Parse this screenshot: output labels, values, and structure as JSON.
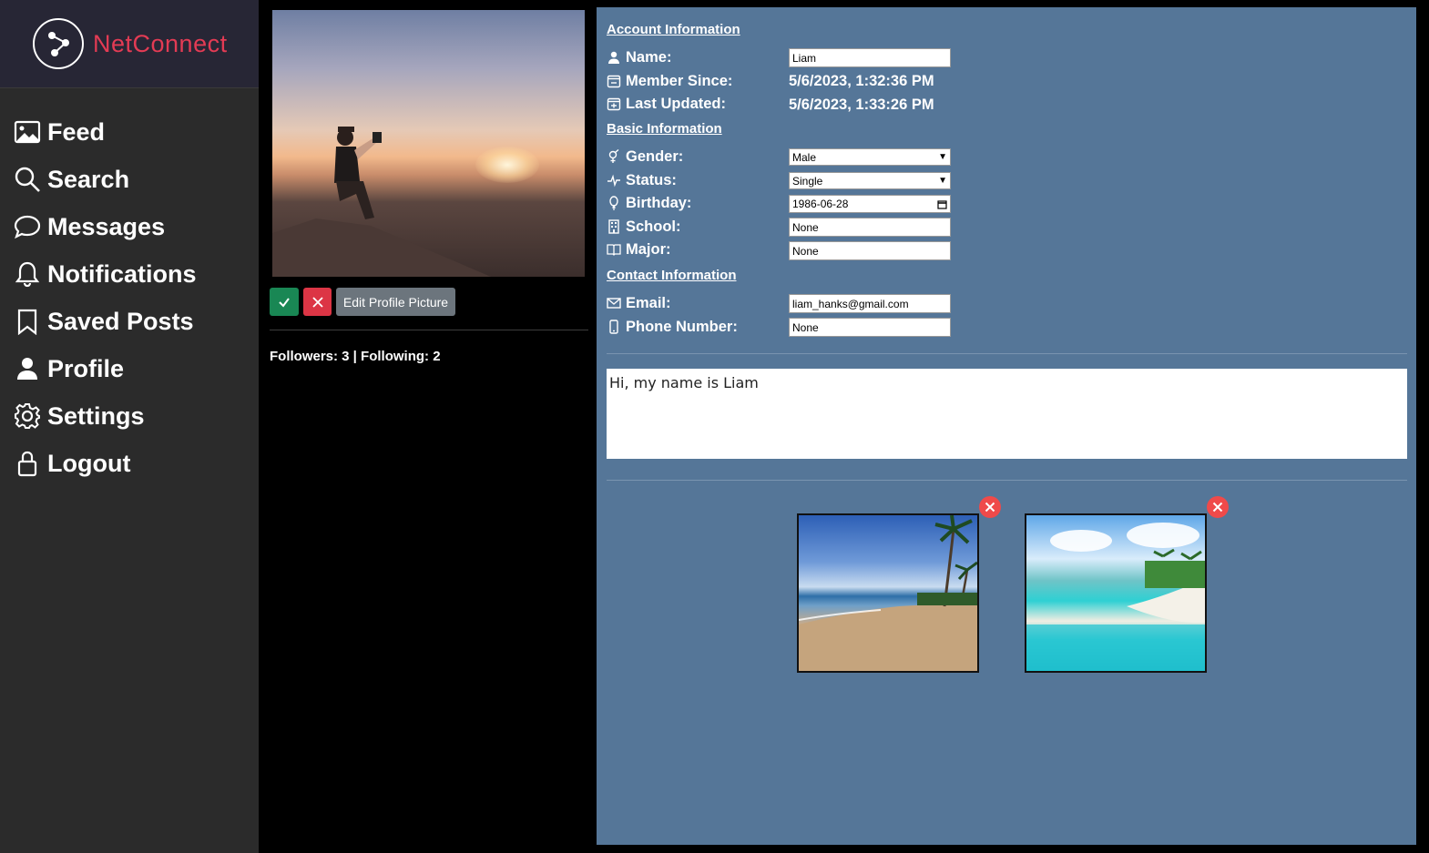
{
  "brand": {
    "name": "NetConnect",
    "color": "#e33b54"
  },
  "nav": [
    {
      "label": "Feed",
      "icon": "image-icon"
    },
    {
      "label": "Search",
      "icon": "search-icon"
    },
    {
      "label": "Messages",
      "icon": "chat-icon"
    },
    {
      "label": "Notifications",
      "icon": "bell-icon"
    },
    {
      "label": "Saved Posts",
      "icon": "bookmark-icon"
    },
    {
      "label": "Profile",
      "icon": "person-icon"
    },
    {
      "label": "Settings",
      "icon": "gear-icon"
    },
    {
      "label": "Logout",
      "icon": "lock-icon"
    }
  ],
  "profile": {
    "edit_picture_label": "Edit Profile Picture",
    "follow_text": "Followers: 3 | Following: 2"
  },
  "account": {
    "title": "Account Information",
    "name_label": "Name:",
    "name_value": "Liam",
    "member_since_label": "Member Since:",
    "member_since_value": "5/6/2023, 1:32:36 PM",
    "last_updated_label": "Last Updated:",
    "last_updated_value": "5/6/2023, 1:33:26 PM"
  },
  "basic": {
    "title": "Basic Information",
    "gender_label": "Gender:",
    "gender_value": "Male",
    "status_label": "Status:",
    "status_value": "Single",
    "birthday_label": "Birthday:",
    "birthday_value": "1986-06-28",
    "school_label": "School:",
    "school_value": "None",
    "major_label": "Major:",
    "major_value": "None"
  },
  "contact": {
    "title": "Contact Information",
    "email_label": "Email:",
    "email_value": "liam_hanks@gmail.com",
    "phone_label": "Phone Number:",
    "phone_value": "None"
  },
  "bio": "Hi, my name is Liam",
  "colors": {
    "panel": "#557698",
    "sidebar": "#2b2b2b",
    "confirm": "#198754",
    "cancel": "#dc3545",
    "secondary": "#6c757d"
  }
}
